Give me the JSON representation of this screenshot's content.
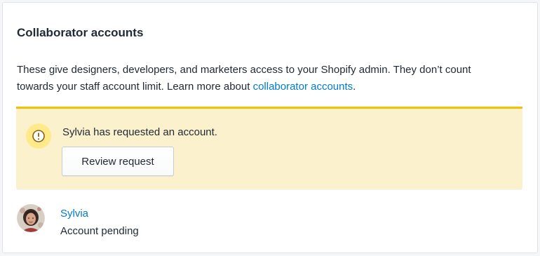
{
  "card": {
    "title": "Collaborator accounts",
    "description_text": "These give designers, developers, and marketers access to your Shopify admin. They don’t count towards your staff account limit. Learn more about ",
    "description_link": "collaborator accounts",
    "description_suffix": "."
  },
  "banner": {
    "icon": "warning-circle-icon",
    "message": "Sylvia has requested an account.",
    "button_label": "Review request"
  },
  "collaborator": {
    "name": "Sylvia",
    "status": "Account pending",
    "avatar": "avatar-photo"
  },
  "colors": {
    "link": "#007ace",
    "banner_background": "#fcf1cd",
    "banner_accent": "#eec200",
    "text": "#212b36"
  }
}
